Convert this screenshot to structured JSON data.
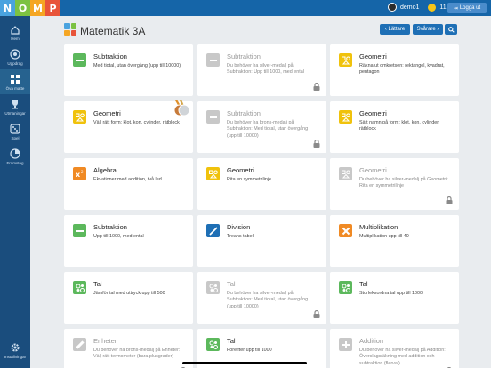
{
  "logo": [
    "N",
    "O",
    "M",
    "P"
  ],
  "logo_colors": [
    "#4aa3df",
    "#7cc242",
    "#f5a623",
    "#e8543a"
  ],
  "user": {
    "name": "demo1",
    "coins": "115",
    "logout": "Logga ut"
  },
  "sidebar": [
    {
      "label": "Hem",
      "icon": "home-icon"
    },
    {
      "label": "Uppdrag",
      "icon": "target-icon"
    },
    {
      "label": "Öva matte",
      "icon": "grid-icon",
      "active": true
    },
    {
      "label": "Utmaningar",
      "icon": "trophy-icon"
    },
    {
      "label": "Spel",
      "icon": "dice-icon"
    },
    {
      "label": "Framsteg",
      "icon": "chart-icon"
    },
    {
      "label": "Inställningar",
      "icon": "gear-icon"
    }
  ],
  "header": {
    "title": "Matematik 3A",
    "easier": "Lättare",
    "harder": "Svårare"
  },
  "cards": [
    {
      "title": "Subtraktion",
      "desc": "Med tiotal, utan övergång (upp till 10000)",
      "color": "#5cb85c",
      "icon": "minus-icon",
      "locked": false
    },
    {
      "title": "Subtraktion",
      "desc": "Du behöver ha silver-medalj på Subtraktion: Upp till 1000, med ental",
      "color": "#c8c8c8",
      "icon": "minus-icon",
      "locked": true
    },
    {
      "title": "Geometri",
      "desc": "Räkna ut omkretsen: rektangel, kvadrat, pentagon",
      "color": "#f0c20c",
      "icon": "geometry-icon",
      "locked": false
    },
    {
      "title": "Geometri",
      "desc": "Välj rätt form: klot, kon, cylinder, rätblock",
      "color": "#f0c20c",
      "icon": "geometry-icon",
      "locked": false,
      "medal": true
    },
    {
      "title": "Subtraktion",
      "desc": "Du behöver ha brons-medalj på Subtraktion: Med tiotal, utan övergång (upp till 10000)",
      "color": "#c8c8c8",
      "icon": "minus-icon",
      "locked": true
    },
    {
      "title": "Geometri",
      "desc": "Sätt namn på form: klot, kon, cylinder, rätblock",
      "color": "#f0c20c",
      "icon": "geometry-icon",
      "locked": false
    },
    {
      "title": "Algebra",
      "desc": "Ekvationer med addition, två led",
      "color": "#f08a24",
      "icon": "algebra-icon",
      "locked": false
    },
    {
      "title": "Geometri",
      "desc": "Rita en symmetrilinje",
      "color": "#f0c20c",
      "icon": "geometry-icon",
      "locked": false
    },
    {
      "title": "Geometri",
      "desc": "Du behöver ha silver-medalj på Geometri: Rita en symmetrilinje",
      "color": "#c8c8c8",
      "icon": "geometry-icon",
      "locked": true
    },
    {
      "title": "Subtraktion",
      "desc": "Upp till 1000, med ental",
      "color": "#5cb85c",
      "icon": "minus-icon",
      "locked": false
    },
    {
      "title": "Division",
      "desc": "Treans tabell",
      "color": "#1e6fb5",
      "icon": "division-icon",
      "locked": false
    },
    {
      "title": "Multiplikation",
      "desc": "Multiplikation upp till 40",
      "color": "#f08a24",
      "icon": "times-icon",
      "locked": false
    },
    {
      "title": "Tal",
      "desc": "Jämför tal med uttryck upp till 500",
      "color": "#5cb85c",
      "icon": "numbers-icon",
      "locked": false
    },
    {
      "title": "Tal",
      "desc": "Du behöver ha silver-medalj på Subtraktion: Med tiotal, utan övergång (upp till 10000)",
      "color": "#c8c8c8",
      "icon": "numbers-icon",
      "locked": true
    },
    {
      "title": "Tal",
      "desc": "Storleksordna tal upp till 1000",
      "color": "#5cb85c",
      "icon": "numbers-icon",
      "locked": false
    },
    {
      "title": "Enheter",
      "desc": "Du behöver ha brons-medalj på Enheter: Välj rätt termometer (bara plusgrader)",
      "color": "#c8c8c8",
      "icon": "ruler-icon",
      "locked": true
    },
    {
      "title": "Tal",
      "desc": "Föreifter upp till 1000",
      "color": "#5cb85c",
      "icon": "numbers-icon",
      "locked": false
    },
    {
      "title": "Addition",
      "desc": "Du behöver ha silver-medalj på Addition: Överslagsräkning med addition och subtraktion (flerval)",
      "color": "#c8c8c8",
      "icon": "plus-icon",
      "locked": true
    }
  ]
}
